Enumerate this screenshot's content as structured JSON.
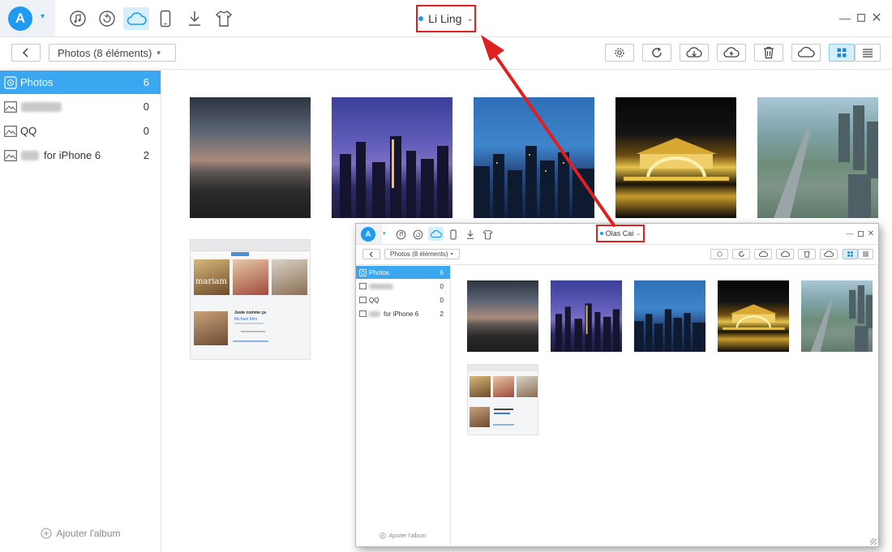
{
  "main": {
    "account_name": "Li Ling",
    "crumb_label": "Photos (8 éléments)",
    "sidebar": {
      "items": [
        {
          "label": "Photos",
          "count": "6"
        },
        {
          "label": "",
          "count": "0"
        },
        {
          "label": "QQ",
          "count": "0"
        },
        {
          "label": "for iPhone 6",
          "count": "2"
        }
      ],
      "add_album": "Ajouter l'album"
    }
  },
  "overlay": {
    "account_name": "Olas Cai",
    "crumb_label": "Photos (8 éléments)",
    "sidebar": {
      "items": [
        {
          "label": "Photos",
          "count": "6"
        },
        {
          "label": "",
          "count": "0"
        },
        {
          "label": "QQ",
          "count": "0"
        },
        {
          "label": "for iPhone 6",
          "count": "2"
        }
      ],
      "add_album": "Ajouter l'album"
    }
  },
  "screenshot_thumb": {
    "track_title": "Juste comme ça",
    "artist": "Michael Miro",
    "album_word": "mariam"
  },
  "colors": {
    "accent": "#1e9bf0",
    "highlight": "#e02020",
    "sidebar_active": "#3ba7f0"
  }
}
